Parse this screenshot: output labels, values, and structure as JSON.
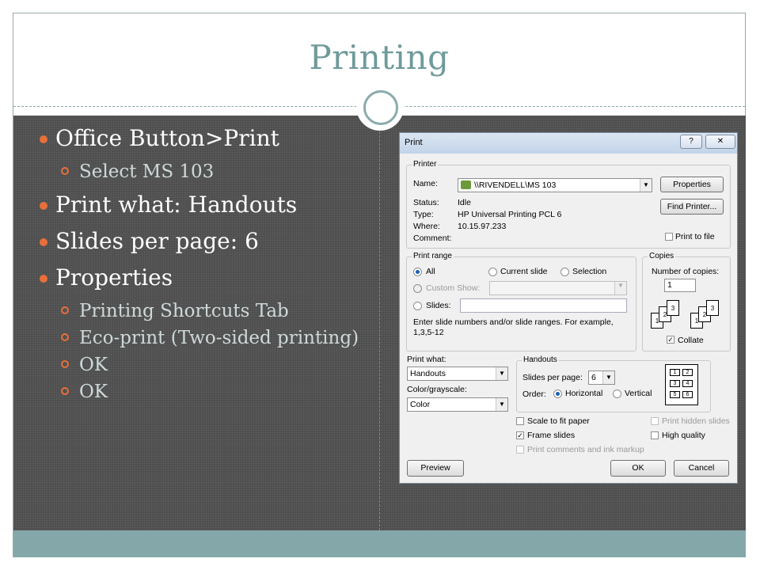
{
  "slide": {
    "title": "Printing",
    "bullets": [
      {
        "text": "Office Button>Print",
        "subs": [
          "Select MS 103"
        ]
      },
      {
        "text": "Print what: Handouts",
        "subs": []
      },
      {
        "text": "Slides per page: 6",
        "subs": []
      },
      {
        "text": "Properties",
        "subs": [
          "Printing Shortcuts Tab",
          "Eco-print (Two-sided printing)",
          "OK",
          "OK"
        ]
      }
    ]
  },
  "colors": {
    "accent": "#e86f3a",
    "title": "#6f9a9a",
    "footer": "#84a8aa",
    "panel": "#4e4e4e"
  },
  "dialog": {
    "title": "Print",
    "help_button": "?",
    "close_button": "✕",
    "printer": {
      "group_label": "Printer",
      "name_label": "Name:",
      "name_value": "\\\\RIVENDELL\\MS 103",
      "status_label": "Status:",
      "status_value": "Idle",
      "type_label": "Type:",
      "type_value": "HP Universal Printing PCL 6",
      "where_label": "Where:",
      "where_value": "10.15.97.233",
      "comment_label": "Comment:",
      "properties_button": "Properties",
      "find_printer_button": "Find Printer...",
      "print_to_file_label": "Print to file"
    },
    "print_range": {
      "group_label": "Print range",
      "all": "All",
      "current_slide": "Current slide",
      "selection": "Selection",
      "custom_show": "Custom Show:",
      "slides": "Slides:",
      "hint": "Enter slide numbers and/or slide ranges. For example, 1,3,5-12"
    },
    "copies": {
      "group_label": "Copies",
      "number_label": "Number of copies:",
      "number_value": "1",
      "collate_label": "Collate",
      "pages_a": [
        "1",
        "2",
        "3"
      ],
      "pages_b": [
        "1",
        "2",
        "3"
      ]
    },
    "print_what": {
      "label": "Print what:",
      "value": "Handouts"
    },
    "color": {
      "label": "Color/grayscale:",
      "value": "Color"
    },
    "handouts": {
      "group_label": "Handouts",
      "slides_per_page_label": "Slides per page:",
      "slides_per_page_value": "6",
      "order_label": "Order:",
      "horizontal": "Horizontal",
      "vertical": "Vertical",
      "preview_cells": [
        "1",
        "2",
        "3",
        "4",
        "5",
        "6"
      ]
    },
    "options": {
      "scale_to_fit": "Scale to fit paper",
      "frame_slides": "Frame slides",
      "print_comments": "Print comments and ink markup",
      "print_hidden": "Print hidden slides",
      "high_quality": "High quality"
    },
    "buttons": {
      "preview": "Preview",
      "ok": "OK",
      "cancel": "Cancel"
    }
  }
}
